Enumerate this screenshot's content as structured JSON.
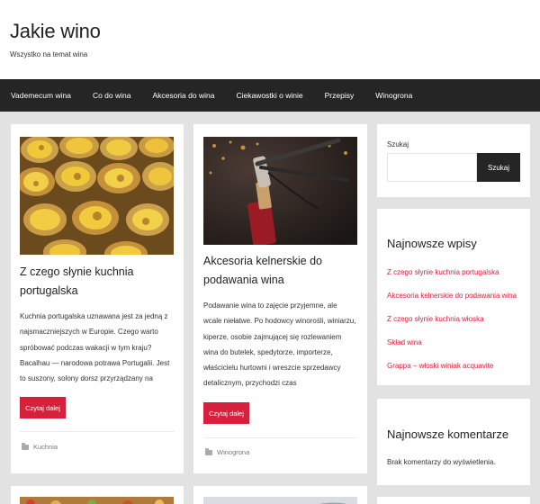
{
  "site": {
    "title": "Jakie wino",
    "description": "Wszystko na temat wina"
  },
  "nav": {
    "items": [
      "Vademecum wina",
      "Co do wina",
      "Akcesoria do wina",
      "Ciekawostki o winie",
      "Przepisy",
      "Winogrona"
    ]
  },
  "posts": [
    {
      "title_line1": "Z czego słynie kuchnia",
      "title_line2": "portugalska",
      "excerpt": [
        "Kuchnia portugalska uznawana jest za jedną z",
        "najsmaczniejszych w Europie. Czego warto",
        "spróbować podczas wakacji w tym kraju?",
        "Bacalhau — narodowa potrawa Portugalii. Jest",
        "to suszony, solony dorsz przyrządzany na"
      ],
      "read_more": "Czytaj dalej",
      "category": "Kuchnia",
      "category_icon": "folder-icon"
    },
    {
      "title_line1": "Akcesoria kelnerskie do",
      "title_line2": "podawania wina",
      "excerpt": [
        "Podawanie wina to zajęcie przyjemne, ale",
        "wcale niełatwe. Po hodowcy winorośli, winiarzu,",
        "kiperze, osobie zajmującej się rozlewaniem",
        "wina do butelek, spedytorze, importerze,",
        "właścicielu hurtowni i wreszcie sprzedawcy",
        "detalicznym, przychodzi czas"
      ],
      "read_more": "Czytaj dalej",
      "category": "Winogrona",
      "category_icon": "folder-icon"
    }
  ],
  "sidebar": {
    "search": {
      "label": "Szukaj",
      "placeholder": "",
      "button": "Szukaj"
    },
    "recent_posts": {
      "title": "Najnowsze wpisy",
      "items": [
        "Z czego słynie kuchnia portugalska",
        "Akcesoria kelnerskie do podawania wina",
        "Z czego słynie kuchnia włoska",
        "Skład wina",
        "Grappa – włoski winiak acquavite"
      ]
    },
    "recent_comments": {
      "title": "Najnowsze komentarze",
      "empty_text": "Brak komentarzy do wyświetlenia."
    }
  },
  "colors": {
    "accent": "#d7203c",
    "dark": "#252525",
    "background": "#e2e2e2"
  }
}
